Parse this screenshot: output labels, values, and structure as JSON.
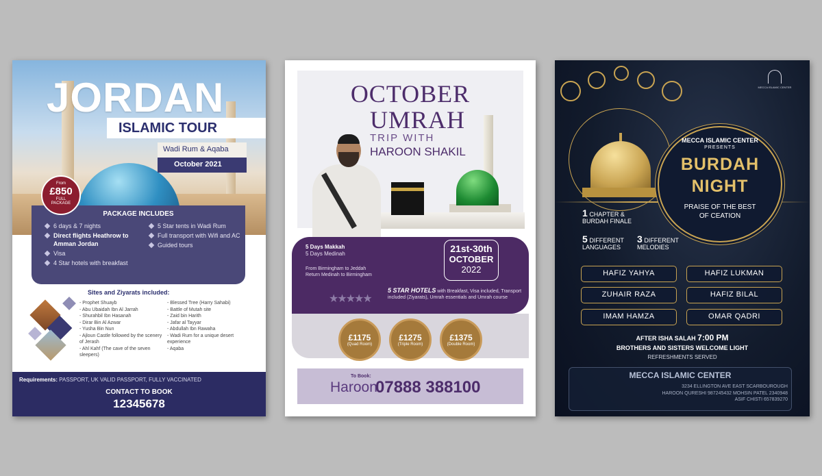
{
  "poster_jordan": {
    "title": "JORDAN",
    "subtitle": "ISLAMIC TOUR",
    "location": "Wadi Rum & Aqaba",
    "date": "October 2021",
    "price": {
      "from": "From",
      "amount": "£850",
      "full": "FULL",
      "package": "PACKAGE"
    },
    "package_title": "PACKAGE INCLUDES",
    "package_left": [
      "6 days & 7 nights",
      "Direct flights Heathrow to Amman Jordan",
      "Visa",
      "4 Star hotels with breakfast"
    ],
    "package_right": [
      "5 Star tents in Wadi Rum",
      "Full transport with Wifi and AC",
      "Guided tours"
    ],
    "sites_title": "Sites and Ziyarats included:",
    "sites_left": [
      "Prophet Shuayb",
      "Abu Ubaidah Ibn Al Jarrah",
      "Shurahbil Ibn Hasanah",
      "Dirar Bin Al Azwar",
      "Yusha Bin Nun",
      "Ajloun Castle followed by the scenery of Jerash",
      "Ahl Kahf (The cave of the seven sleepers)"
    ],
    "sites_right": [
      "Blessed Tree (Harry Sahabi)",
      "Battle of Mutah site",
      "Zaid bin Harith",
      "Jafar al Tayyar",
      "Abdullah Ibn Rawaha",
      "Wadi Rum for a unique desert experience",
      "Aqaba"
    ],
    "requirements_label": "Requirements:",
    "requirements_text": "PASSPORT, UK VALID PASSPORT, FULLY VACCINATED",
    "contact_label": "CONTACT TO BOOK",
    "contact_phone": "12345678"
  },
  "poster_umrah": {
    "line1": "OCTOBER",
    "line2": "UMRAH",
    "line3": "TRIP WITH",
    "line4": "HAROON SHAKIL",
    "days_makkah": "5 Days Makkah",
    "days_madinah": "5 Days Medinah",
    "flight1": "From Birmingham to Jeddah",
    "flight2": "Return Medinah to Birmingham",
    "date_range": "21st-30th",
    "date_month": "OCTOBER",
    "date_year": "2022",
    "stars": "★★★★★",
    "hotels_title": "5 STAR HOTELS",
    "hotels_text": "with Breakfast, Visa included, Transport included (Ziyarats), Umrah essentials and Umrah course",
    "prices": [
      {
        "amount": "£1175",
        "room": "(Quad Room)"
      },
      {
        "amount": "£1275",
        "room": "(Triple Room)"
      },
      {
        "amount": "£1375",
        "room": "(Double Room)"
      }
    ],
    "to_book": "To Book:",
    "book_name": "Haroon",
    "book_phone": "07888 388100"
  },
  "poster_burdah": {
    "logo_text": "MECCA ISLAMIC CENTER",
    "organizer": "MECCA ISLAMIC CENTER",
    "presents": "PRESENTS",
    "title1": "BURDAH",
    "title2": "NIGHT",
    "praise1": "PRAISE OF THE BEST",
    "praise2": "OF CEATION",
    "chapter_num": "1",
    "chapter_text1": "CHAPTER &",
    "chapter_text2": "BURDAH FINALE",
    "lang_num": "5",
    "lang_text1": "DIFFERENT",
    "lang_text2": "LANGUAGES",
    "mel_num": "3",
    "mel_text1": "DIFFERENT",
    "mel_text2": "MELODIES",
    "performers": [
      "HAFIZ YAHYA",
      "HAFIZ LUKMAN",
      "ZUHAIR RAZA",
      "HAFIZ BILAL",
      "IMAM HAMZA",
      "OMAR QADRI"
    ],
    "after": "AFTER ISHA SALAH",
    "time": "7:00 PM",
    "welcome": "BROTHERS AND SISTERS WELCOME LIGHT",
    "refresh": "REFRESHMENTS SERVED",
    "center_name": "MECCA ISLAMIC CENTER",
    "address": "3234 ELLINGTON AVE EAST SCARBOUROUGH",
    "contacts": "HAROON QURESHI 987245432 MOHSIN PATEL 2340948",
    "contacts2": "ASIF CHISTI 657839270"
  },
  "colors": {
    "background": "#bcbcbc",
    "navy": "#2c2c63",
    "purple": "#4c2a64",
    "gold": "#c9a452"
  }
}
